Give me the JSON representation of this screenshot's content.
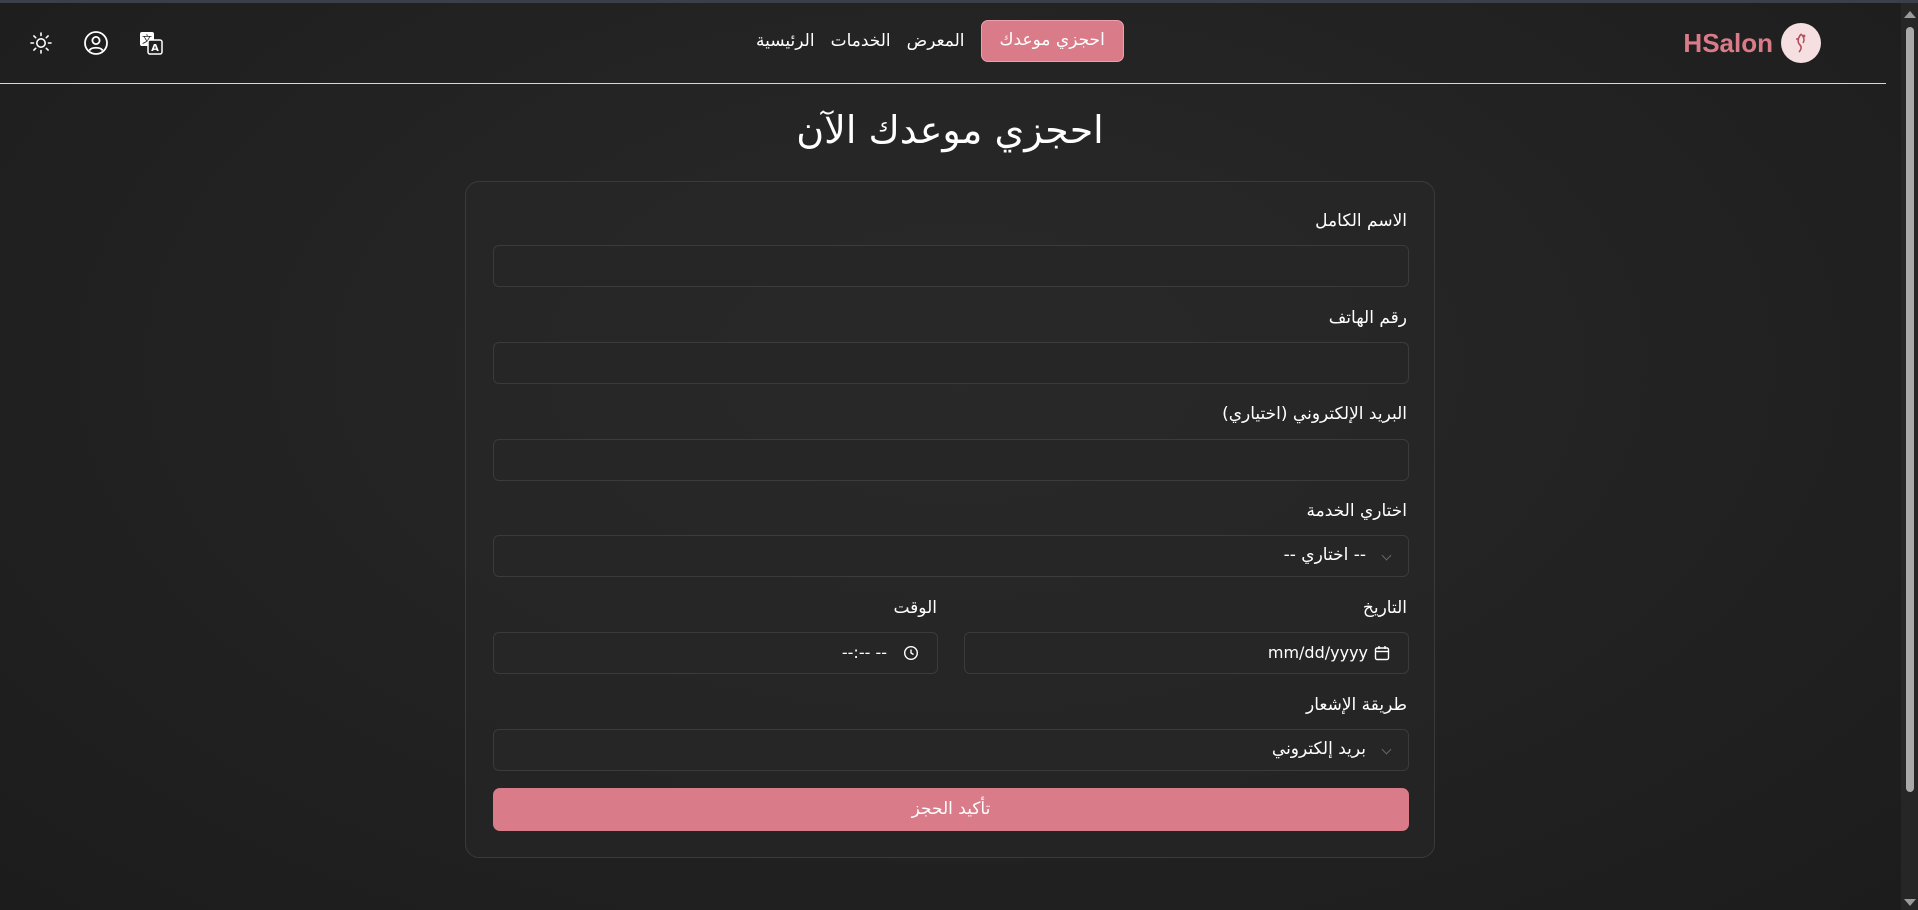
{
  "nav": {
    "brand": "HSalon",
    "links": {
      "home": "الرئيسية",
      "services": "الخدمات",
      "gallery": "المعرض"
    },
    "cta": "احجزي موعدك",
    "icons": [
      "sun-icon",
      "user-icon",
      "translate-icon"
    ]
  },
  "page": {
    "title": "احجزي موعدك الآن"
  },
  "form": {
    "full_name_label": "الاسم الكامل",
    "full_name_value": "",
    "phone_label": "رقم الهاتف",
    "phone_value": "",
    "email_label": "البريد الإلكتروني (اختياري)",
    "email_value": "",
    "service_label": "اختاري الخدمة",
    "service_selected": "-- اختاري --",
    "date_label": "التاريخ",
    "date_value": "mm/dd/yyyy",
    "time_label": "الوقت",
    "time_value": "--:-- --",
    "notify_label": "طريقة الإشعار",
    "notify_selected": "بريد إلكتروني",
    "submit_label": "تأكيد الحجز"
  },
  "colors": {
    "accent": "#d97b88",
    "background": "#222222",
    "text": "#ffffff"
  }
}
